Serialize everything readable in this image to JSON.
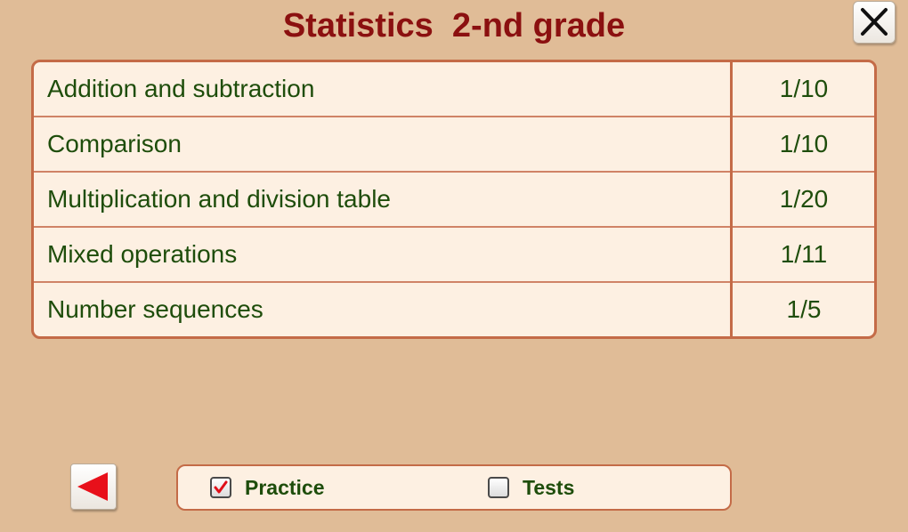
{
  "header": {
    "title": "Statistics  2-nd grade"
  },
  "stats": {
    "rows": [
      {
        "topic": "Addition and subtraction",
        "score": "1/10"
      },
      {
        "topic": "Comparison",
        "score": "1/10"
      },
      {
        "topic": "Multiplication and division table",
        "score": "1/20"
      },
      {
        "topic": "Mixed operations",
        "score": "1/11"
      },
      {
        "topic": "Number sequences",
        "score": "1/5"
      }
    ]
  },
  "filters": {
    "practice": {
      "label": "Practice",
      "checked": true
    },
    "tests": {
      "label": "Tests",
      "checked": false
    }
  },
  "controls": {
    "close_icon": "close-icon",
    "back_icon": "back-arrow-icon"
  },
  "colors": {
    "background": "#e0bc97",
    "title": "#8b1010",
    "text": "#1e4d0b",
    "border": "#c46b47",
    "panel": "#fdf0e2",
    "check": "#e0101a"
  }
}
